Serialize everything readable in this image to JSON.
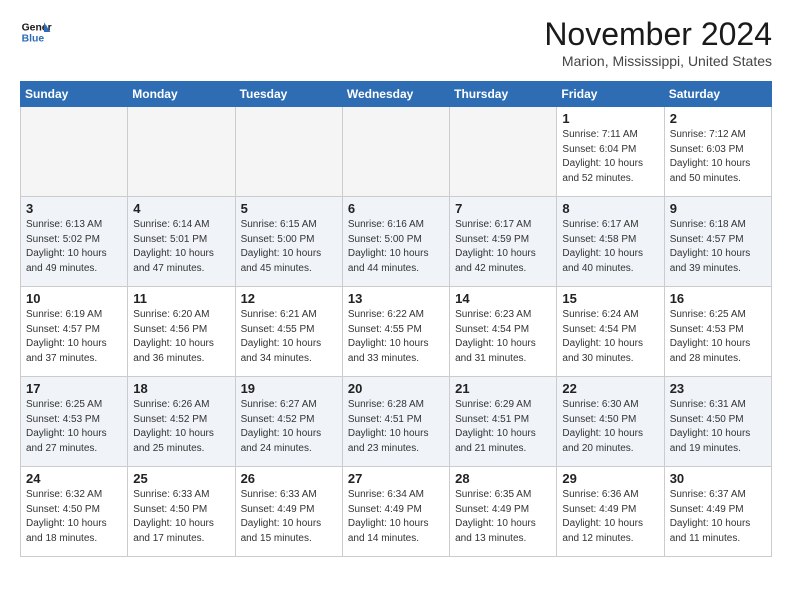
{
  "header": {
    "logo_line1": "General",
    "logo_line2": "Blue",
    "month": "November 2024",
    "location": "Marion, Mississippi, United States"
  },
  "weekdays": [
    "Sunday",
    "Monday",
    "Tuesday",
    "Wednesday",
    "Thursday",
    "Friday",
    "Saturday"
  ],
  "weeks": [
    [
      {
        "day": "",
        "info": ""
      },
      {
        "day": "",
        "info": ""
      },
      {
        "day": "",
        "info": ""
      },
      {
        "day": "",
        "info": ""
      },
      {
        "day": "",
        "info": ""
      },
      {
        "day": "1",
        "info": "Sunrise: 7:11 AM\nSunset: 6:04 PM\nDaylight: 10 hours\nand 52 minutes."
      },
      {
        "day": "2",
        "info": "Sunrise: 7:12 AM\nSunset: 6:03 PM\nDaylight: 10 hours\nand 50 minutes."
      }
    ],
    [
      {
        "day": "3",
        "info": "Sunrise: 6:13 AM\nSunset: 5:02 PM\nDaylight: 10 hours\nand 49 minutes."
      },
      {
        "day": "4",
        "info": "Sunrise: 6:14 AM\nSunset: 5:01 PM\nDaylight: 10 hours\nand 47 minutes."
      },
      {
        "day": "5",
        "info": "Sunrise: 6:15 AM\nSunset: 5:00 PM\nDaylight: 10 hours\nand 45 minutes."
      },
      {
        "day": "6",
        "info": "Sunrise: 6:16 AM\nSunset: 5:00 PM\nDaylight: 10 hours\nand 44 minutes."
      },
      {
        "day": "7",
        "info": "Sunrise: 6:17 AM\nSunset: 4:59 PM\nDaylight: 10 hours\nand 42 minutes."
      },
      {
        "day": "8",
        "info": "Sunrise: 6:17 AM\nSunset: 4:58 PM\nDaylight: 10 hours\nand 40 minutes."
      },
      {
        "day": "9",
        "info": "Sunrise: 6:18 AM\nSunset: 4:57 PM\nDaylight: 10 hours\nand 39 minutes."
      }
    ],
    [
      {
        "day": "10",
        "info": "Sunrise: 6:19 AM\nSunset: 4:57 PM\nDaylight: 10 hours\nand 37 minutes."
      },
      {
        "day": "11",
        "info": "Sunrise: 6:20 AM\nSunset: 4:56 PM\nDaylight: 10 hours\nand 36 minutes."
      },
      {
        "day": "12",
        "info": "Sunrise: 6:21 AM\nSunset: 4:55 PM\nDaylight: 10 hours\nand 34 minutes."
      },
      {
        "day": "13",
        "info": "Sunrise: 6:22 AM\nSunset: 4:55 PM\nDaylight: 10 hours\nand 33 minutes."
      },
      {
        "day": "14",
        "info": "Sunrise: 6:23 AM\nSunset: 4:54 PM\nDaylight: 10 hours\nand 31 minutes."
      },
      {
        "day": "15",
        "info": "Sunrise: 6:24 AM\nSunset: 4:54 PM\nDaylight: 10 hours\nand 30 minutes."
      },
      {
        "day": "16",
        "info": "Sunrise: 6:25 AM\nSunset: 4:53 PM\nDaylight: 10 hours\nand 28 minutes."
      }
    ],
    [
      {
        "day": "17",
        "info": "Sunrise: 6:25 AM\nSunset: 4:53 PM\nDaylight: 10 hours\nand 27 minutes."
      },
      {
        "day": "18",
        "info": "Sunrise: 6:26 AM\nSunset: 4:52 PM\nDaylight: 10 hours\nand 25 minutes."
      },
      {
        "day": "19",
        "info": "Sunrise: 6:27 AM\nSunset: 4:52 PM\nDaylight: 10 hours\nand 24 minutes."
      },
      {
        "day": "20",
        "info": "Sunrise: 6:28 AM\nSunset: 4:51 PM\nDaylight: 10 hours\nand 23 minutes."
      },
      {
        "day": "21",
        "info": "Sunrise: 6:29 AM\nSunset: 4:51 PM\nDaylight: 10 hours\nand 21 minutes."
      },
      {
        "day": "22",
        "info": "Sunrise: 6:30 AM\nSunset: 4:50 PM\nDaylight: 10 hours\nand 20 minutes."
      },
      {
        "day": "23",
        "info": "Sunrise: 6:31 AM\nSunset: 4:50 PM\nDaylight: 10 hours\nand 19 minutes."
      }
    ],
    [
      {
        "day": "24",
        "info": "Sunrise: 6:32 AM\nSunset: 4:50 PM\nDaylight: 10 hours\nand 18 minutes."
      },
      {
        "day": "25",
        "info": "Sunrise: 6:33 AM\nSunset: 4:50 PM\nDaylight: 10 hours\nand 17 minutes."
      },
      {
        "day": "26",
        "info": "Sunrise: 6:33 AM\nSunset: 4:49 PM\nDaylight: 10 hours\nand 15 minutes."
      },
      {
        "day": "27",
        "info": "Sunrise: 6:34 AM\nSunset: 4:49 PM\nDaylight: 10 hours\nand 14 minutes."
      },
      {
        "day": "28",
        "info": "Sunrise: 6:35 AM\nSunset: 4:49 PM\nDaylight: 10 hours\nand 13 minutes."
      },
      {
        "day": "29",
        "info": "Sunrise: 6:36 AM\nSunset: 4:49 PM\nDaylight: 10 hours\nand 12 minutes."
      },
      {
        "day": "30",
        "info": "Sunrise: 6:37 AM\nSunset: 4:49 PM\nDaylight: 10 hours\nand 11 minutes."
      }
    ]
  ]
}
